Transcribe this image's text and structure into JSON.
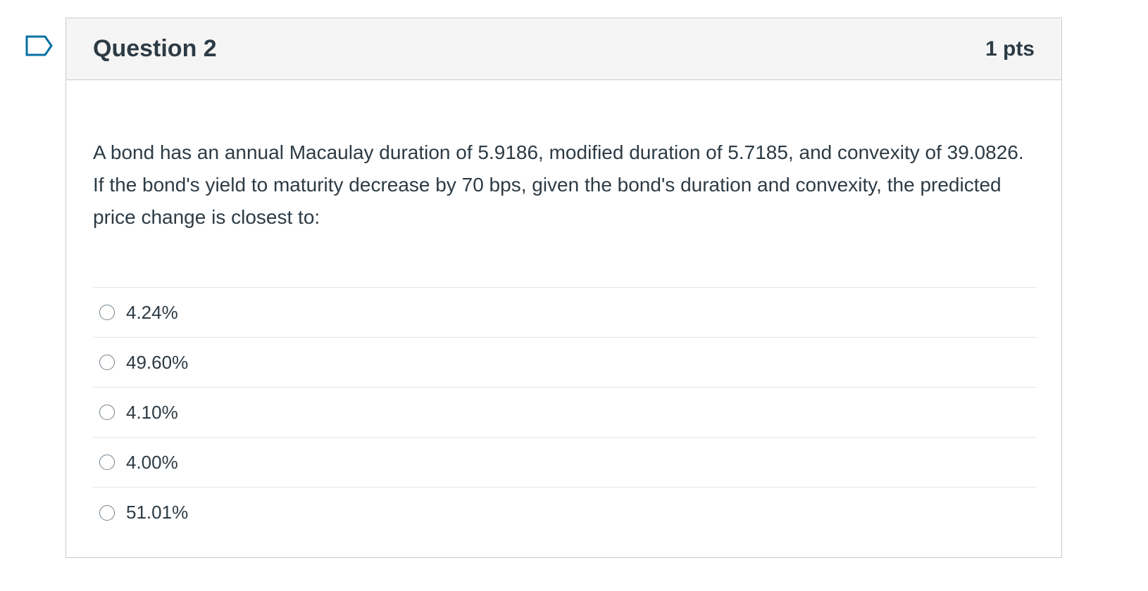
{
  "question": {
    "title": "Question 2",
    "points": "1 pts",
    "flag_icon": "bookmark-flag-icon",
    "text": "A bond has an annual Macaulay duration of 5.9186, modified duration of 5.7185, and convexity of 39.0826. If the bond's yield to maturity decrease by 70 bps, given the bond's duration and convexity, the predicted price change is closest to:",
    "answers": [
      {
        "label": "4.24%"
      },
      {
        "label": "49.60%"
      },
      {
        "label": "4.10%"
      },
      {
        "label": "4.00%"
      },
      {
        "label": "51.01%"
      }
    ]
  },
  "colors": {
    "text": "#2d3b45",
    "header_bg": "#f5f5f5",
    "border": "#c7cdd1",
    "flag": "#0770a3"
  }
}
